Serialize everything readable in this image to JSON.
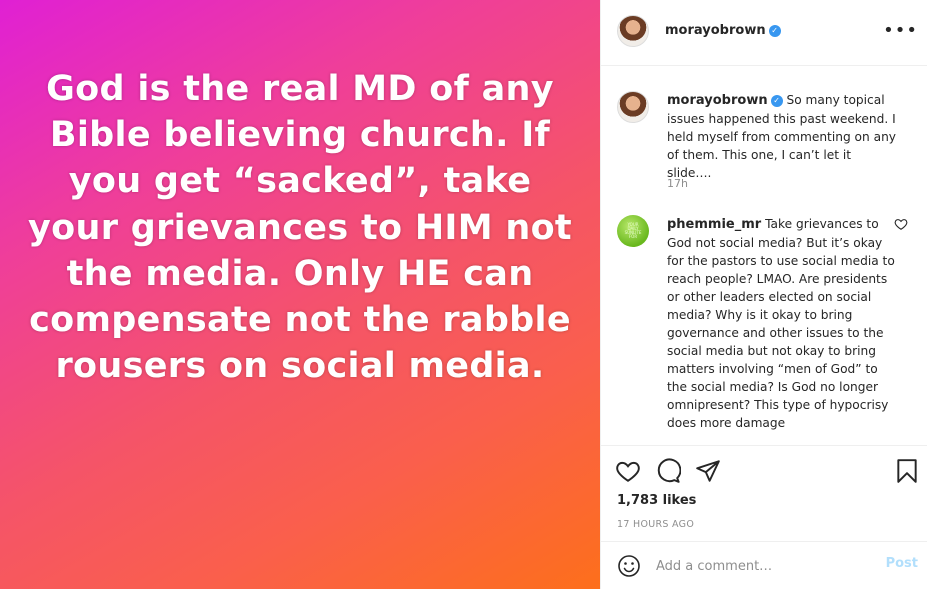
{
  "post": {
    "image_text": "God is the real MD of any Bible believing church. If you get “sacked”, take your grievances to HIM not the media. Only HE can compensate not the rabble rousers on social media."
  },
  "header": {
    "username": "morayobrown",
    "verified_icon": "verified-badge-icon",
    "more_icon": "ellipsis-icon"
  },
  "caption": {
    "username": "morayobrown",
    "text": "So many topical issues happened this past weekend. I held myself from commenting on any of them. This one, I can’t let it slide….",
    "time": "17h"
  },
  "reply": {
    "avatar_text": "YOUR DAILY SUNLITE FOR",
    "username": "phemmie_mr",
    "text": "Take grievances to God not social media? But it’s okay for the pastors to use social media to reach people? LMAO. Are presidents or other leaders elected on social media? Why is it okay to bring governance and other issues to the social media but not okay to bring matters involving “men of God” to the social media? Is God no longer omnipresent? This type of hypocrisy does more damage"
  },
  "actions": {
    "likes": "1,783 likes",
    "time_ago": "17 HOURS AGO"
  },
  "add_comment": {
    "placeholder": "Add a comment…",
    "post_label": "Post"
  },
  "colors": {
    "gradient_start": "#e020d4",
    "gradient_end": "#fd6f1b",
    "verified": "#3897f0",
    "post_button": "#b2dffc"
  }
}
